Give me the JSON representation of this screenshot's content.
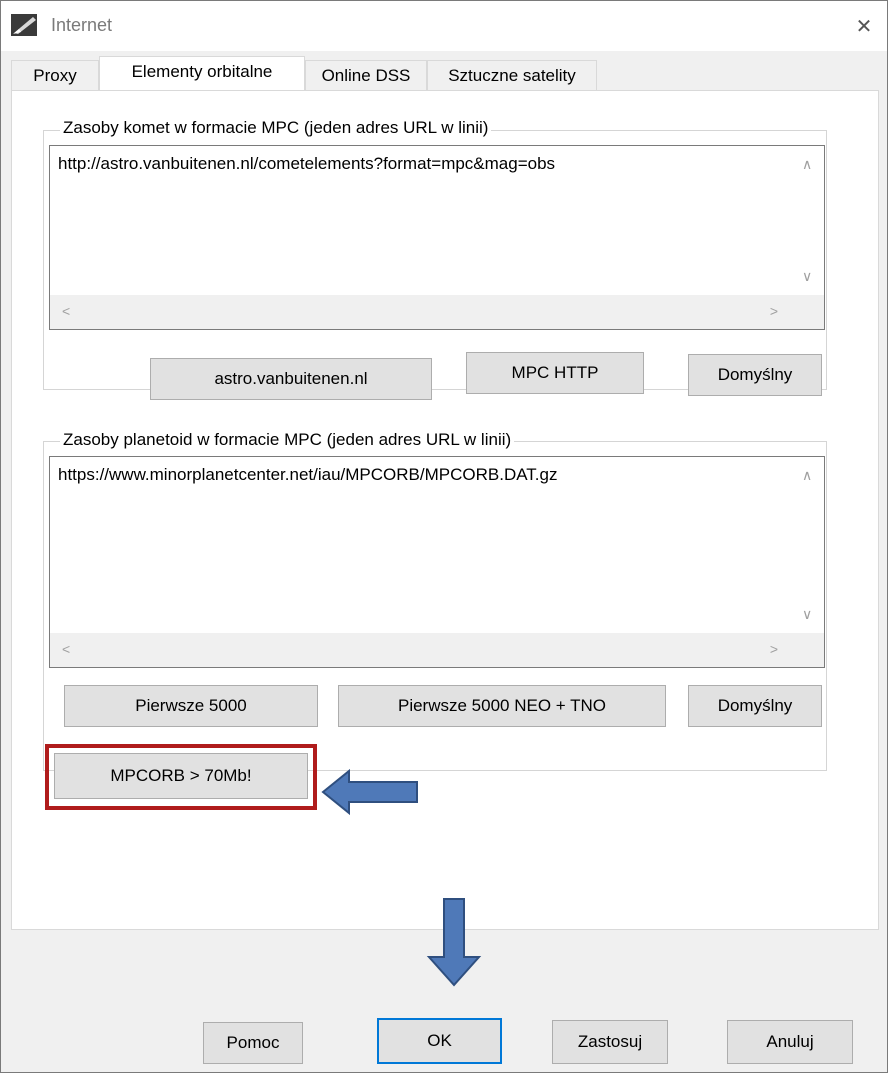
{
  "window": {
    "title": "Internet",
    "close_glyph": "✕",
    "app_icon": "comet-icon"
  },
  "tabs": [
    {
      "label": "Proxy"
    },
    {
      "label": "Elementy orbitalne"
    },
    {
      "label": "Online DSS"
    },
    {
      "label": "Sztuczne satelity"
    }
  ],
  "comets": {
    "legend": "Zasoby komet w formacie MPC (jeden adres URL w linii)",
    "url": "http://astro.vanbuitenen.nl/cometelements?format=mpc&mag=obs",
    "buttons": {
      "astro": "astro.vanbuitenen.nl",
      "mpc_http": "MPC HTTP",
      "default": "Domyślny"
    }
  },
  "asteroids": {
    "legend": "Zasoby planetoid w formacie MPC (jeden adres URL w linii)",
    "url": "https://www.minorplanetcenter.net/iau/MPCORB/MPCORB.DAT.gz",
    "buttons": {
      "first5000": "Pierwsze 5000",
      "first5000_neo": "Pierwsze 5000 NEO + TNO",
      "default": "Domyślny"
    }
  },
  "mpcorb_button": "MPCORB > 70Mb!",
  "scroll_glyphs": {
    "up": "∧",
    "down": "∨",
    "left": "<",
    "right": ">"
  },
  "footer": {
    "help": "Pomoc",
    "ok": "OK",
    "apply": "Zastosuj",
    "cancel": "Anuluj"
  },
  "colors": {
    "highlight_border": "#b01c1c",
    "arrow_fill": "#4f79b8",
    "arrow_stroke": "#2f4f7f",
    "default_button_border": "#0078d7"
  }
}
